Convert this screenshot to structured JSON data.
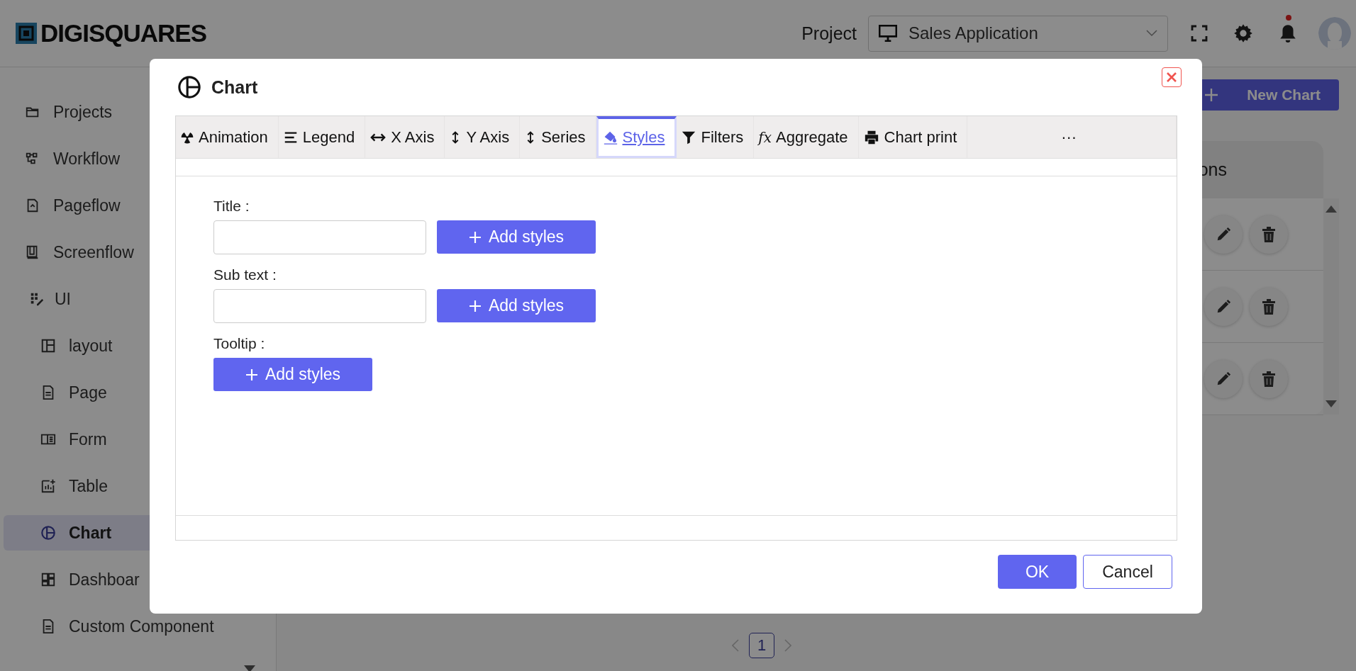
{
  "header": {
    "logo": "DIGISQUARES",
    "project_label": "Project",
    "project": {
      "value": "Sales Application"
    },
    "notifications": {
      "unread": true
    }
  },
  "sidebar": {
    "items": [
      {
        "label": "Projects",
        "selected": false
      },
      {
        "label": "Workflow",
        "selected": false
      },
      {
        "label": "Pageflow",
        "selected": false
      },
      {
        "label": "Screenflow",
        "selected": false
      },
      {
        "label": "UI",
        "selected": false,
        "children": [
          {
            "label": "layout",
            "selected": false
          },
          {
            "label": "Page",
            "selected": false
          },
          {
            "label": "Form",
            "selected": false
          },
          {
            "label": "Table",
            "selected": false
          },
          {
            "label": "Chart",
            "selected": true
          },
          {
            "label": "Dashboar",
            "selected": false
          },
          {
            "label": "Custom Component",
            "selected": false
          }
        ]
      }
    ]
  },
  "main": {
    "new_button": "New Chart",
    "table": {
      "columns": [
        {
          "label": "ons"
        }
      ],
      "rows": [
        {
          "kind": "actions"
        },
        {
          "kind": "actions"
        },
        {
          "kind": "actions"
        }
      ]
    },
    "pagination": [
      {
        "label": "1",
        "selected": true
      }
    ]
  },
  "dialog": {
    "title": "Chart",
    "tabs": [
      {
        "label": "Animation",
        "selected": false
      },
      {
        "label": "Legend",
        "selected": false
      },
      {
        "label": "X Axis",
        "selected": false
      },
      {
        "label": "Y Axis",
        "selected": false
      },
      {
        "label": "Series",
        "selected": false
      },
      {
        "label": "Styles",
        "selected": true
      },
      {
        "label": "Filters",
        "selected": false
      },
      {
        "label": "Aggregate",
        "icon_text": "fx",
        "selected": false
      },
      {
        "label": "Chart print",
        "selected": false
      },
      {
        "label": "···",
        "selected": false
      }
    ],
    "fields": [
      {
        "label": "Title :",
        "kind": "input",
        "button": "Add styles"
      },
      {
        "label": "Sub text :",
        "kind": "input",
        "button": "Add styles"
      },
      {
        "label": "Tooltip :",
        "kind": "button",
        "button": "Add styles"
      }
    ],
    "buttons": [
      {
        "label": "OK",
        "kind": "primary"
      },
      {
        "label": "Cancel",
        "kind": "secondary"
      }
    ]
  }
}
